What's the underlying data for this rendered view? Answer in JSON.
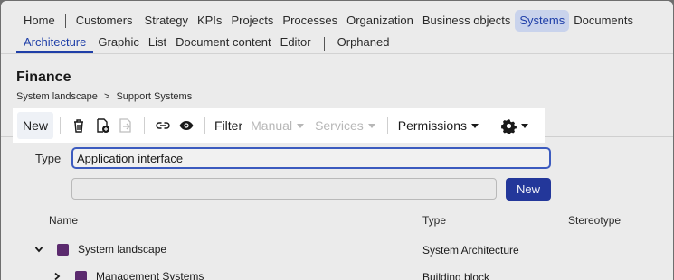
{
  "top_nav": {
    "items": [
      "Home",
      "Customers",
      "Strategy",
      "KPIs",
      "Projects",
      "Processes",
      "Organization",
      "Business objects",
      "Systems",
      "Documents"
    ],
    "active": "Systems"
  },
  "sub_nav": {
    "items": [
      "Architecture",
      "Graphic",
      "List",
      "Document content",
      "Editor",
      "Orphaned"
    ],
    "active": "Architecture"
  },
  "page": {
    "title": "Finance",
    "breadcrumb": [
      "System landscape",
      ">",
      "Support Systems"
    ]
  },
  "toolbar": {
    "new_label": "New",
    "filter_label": "Filter",
    "manual_label": "Manual",
    "services_label": "Services",
    "permissions_label": "Permissions",
    "icons": [
      "trash-icon",
      "add-document-icon",
      "export-icon",
      "link-icon",
      "eye-icon",
      "gear-icon"
    ]
  },
  "form": {
    "type_label": "Type",
    "type_value": "Application interface",
    "search_value": "",
    "new_button_label": "New"
  },
  "table": {
    "columns": [
      "Name",
      "Type",
      "Stereotype"
    ],
    "rows": [
      {
        "name": "System landscape",
        "type": "System Architecture",
        "stereotype": "",
        "expanded": true
      },
      {
        "name": "Management Systems",
        "type": "Building block",
        "stereotype": "",
        "expanded": false
      }
    ]
  },
  "colors": {
    "accent": "#1f3fa8",
    "active_tab_bg": "#c9d3ec",
    "object_color": "#5b2a6e",
    "primary_button": "#23379a"
  }
}
